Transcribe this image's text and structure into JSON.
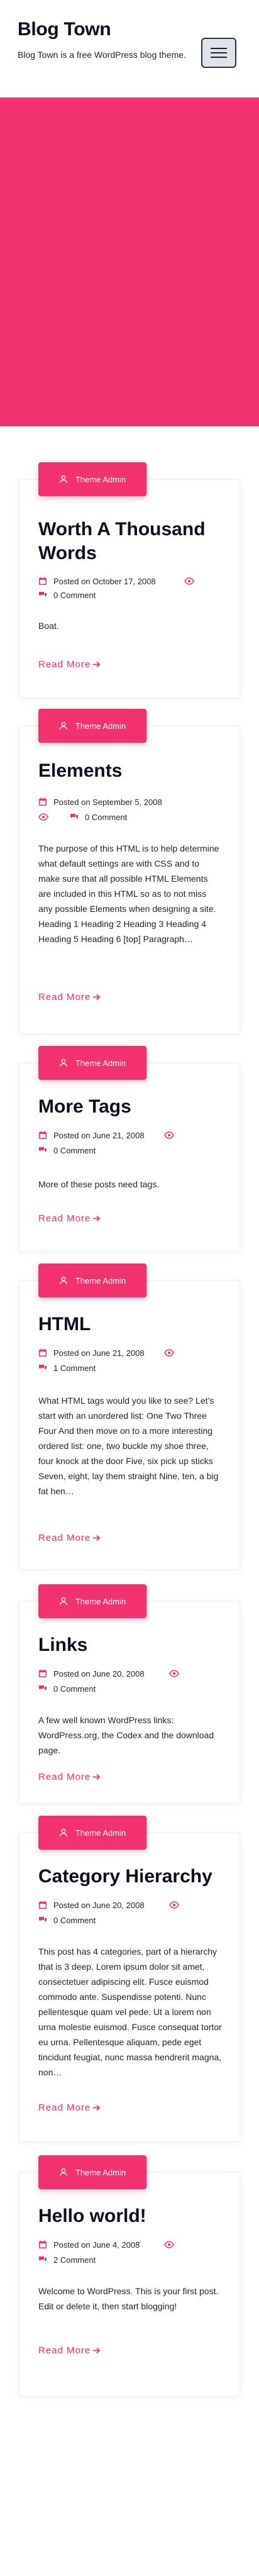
{
  "site": {
    "title": "Blog Town",
    "description": "Blog Town is a free WordPress blog theme."
  },
  "header": {
    "menu_icon": "hamburger-menu-icon"
  },
  "colors": {
    "accent": "#f2316f",
    "heading": "#0c0f1e",
    "text": "#1f2329"
  },
  "posts": [
    {
      "author": "Theme Admin",
      "title": "Worth A Thousand Words",
      "date": "Posted on October 17, 2008",
      "comments": "0 Comment",
      "excerpt": "Boat.",
      "read_more": "Read More"
    },
    {
      "author": "Theme Admin",
      "title": "Elements",
      "date": "Posted on September 5, 2008",
      "comments": "0 Comment",
      "excerpt": "The purpose of this HTML is to help determine what default settings are with CSS and to make sure that all possible HTML Elements are included in this HTML so as to not miss any possible Elements when designing a site. Heading 1 Heading 2 Heading 3 Heading 4 Heading 5 Heading 6 [top] Paragraph…",
      "read_more": "Read More"
    },
    {
      "author": "Theme Admin",
      "title": "More Tags",
      "date": "Posted on June 21, 2008",
      "comments": "0 Comment",
      "excerpt": "More of these posts need tags.",
      "read_more": "Read More"
    },
    {
      "author": "Theme Admin",
      "title": "HTML",
      "date": "Posted on June 21, 2008",
      "comments": "1 Comment",
      "excerpt": "What HTML tags would you like to see? Let’s start with an unordered list: One Two Three Four And then move on to a more interesting ordered list: one, two buckle my shoe three, four knock at the door Five, six pick up sticks Seven, eight, lay them straight Nine, ten, a big fat hen…",
      "read_more": "Read More"
    },
    {
      "author": "Theme Admin",
      "title": "Links",
      "date": "Posted on June 20, 2008",
      "comments": "0 Comment",
      "excerpt": "A few well known WordPress links: WordPress.org, the Codex and the download page.",
      "read_more": "Read More"
    },
    {
      "author": "Theme Admin",
      "title": "Category Hierarchy",
      "date": "Posted on June 20, 2008",
      "comments": "0 Comment",
      "excerpt": "This post has 4 categories, part of a hierarchy that is 3 deep. Lorem ipsum dolor sit amet, consectetuer adipiscing elit. Fusce euismod commodo ante. Suspendisse potenti. Nunc pellentesque quam vel pede. Ut a lorem non urna molestie euismod. Fusce consequat tortor eu urna. Pellentesque aliquam, pede eget tincidunt feugiat, nunc massa hendrerit magna, non…",
      "read_more": "Read More"
    },
    {
      "author": "Theme Admin",
      "title": "Hello world!",
      "date": "Posted on June 4, 2008",
      "comments": "2 Comment",
      "excerpt": "Welcome to WordPress. This is your first post. Edit or delete it, then start blogging!",
      "read_more": "Read More"
    }
  ]
}
